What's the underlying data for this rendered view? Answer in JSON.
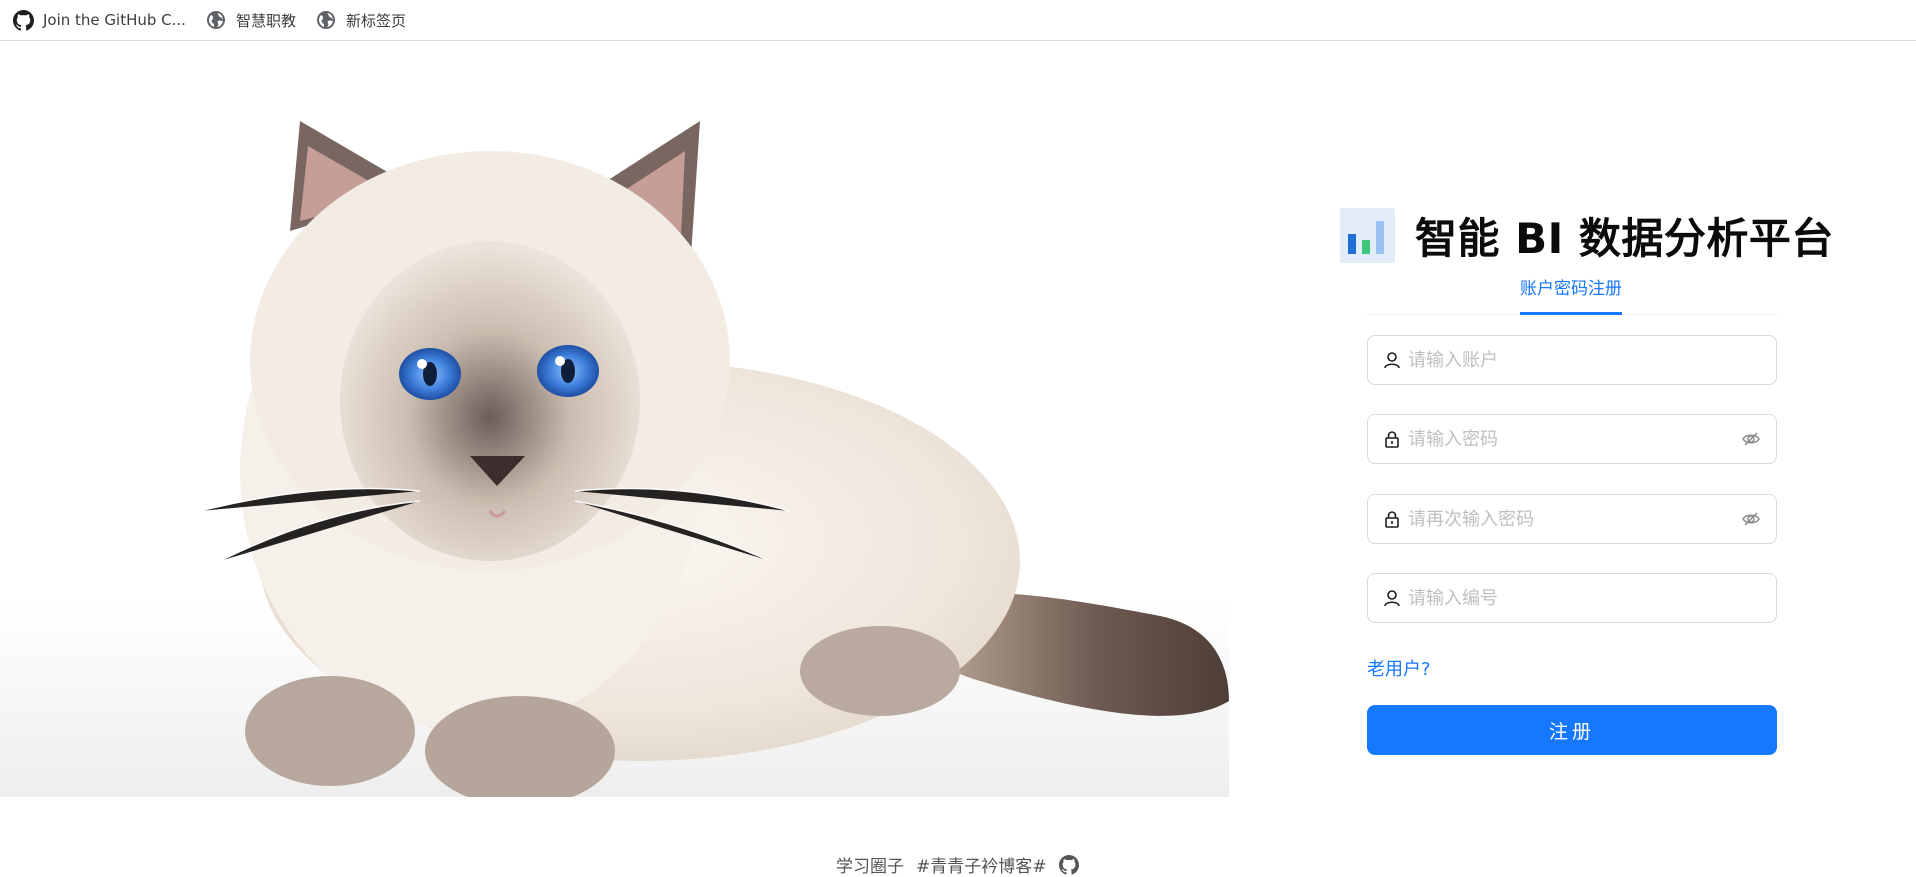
{
  "bookmarks": [
    {
      "label": "Join the GitHub C...",
      "icon": "github-icon"
    },
    {
      "label": "智慧职教",
      "icon": "globe-icon"
    },
    {
      "label": "新标签页",
      "icon": "globe-icon"
    }
  ],
  "hero": {
    "image": "white-ragdoll-kitten-photo"
  },
  "brand": {
    "title": "智能 BI 数据分析平台",
    "logo_icon": "bar-chart-icon"
  },
  "tabs": [
    {
      "label": "账户密码注册",
      "active": true
    }
  ],
  "form": {
    "account_placeholder": "请输入账户",
    "password_placeholder": "请输入密码",
    "confirm_password_placeholder": "请再次输入密码",
    "code_placeholder": "请输入编号"
  },
  "old_user_link": "老用户?",
  "submit_label": "注册",
  "footer": {
    "items": [
      "学习圈子",
      "#青青子衿博客#"
    ],
    "github_icon": "github-icon"
  },
  "colors": {
    "primary": "#1677ff",
    "border": "#d9d9d9",
    "placeholder": "#bfbfbf"
  }
}
